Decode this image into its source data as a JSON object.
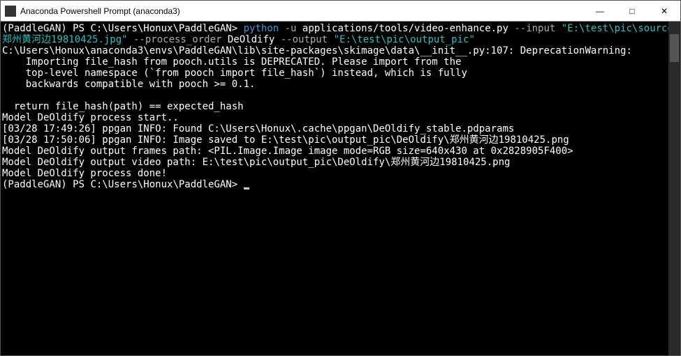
{
  "titlebar": {
    "title": "Anaconda Powershell Prompt (anaconda3)",
    "min": "—",
    "max": "□",
    "close": "✕"
  },
  "term": {
    "prompt_env": "(PaddleGAN) ",
    "prompt_path": "PS C:\\Users\\Honux\\PaddleGAN> ",
    "cmd_python": "python",
    "cmd_flag_u": " -u",
    "cmd_script": " applications/tools/video-enhance.py",
    "cmd_flag_input": " --input",
    "cmd_input_val_1": " \"E:\\test\\pic\\source_pic\\",
    "cmd_input_val_2": "郑州黄河边19810425.jpg\"",
    "cmd_flag_proc": " --process_order",
    "cmd_proc_val": " DeOldify",
    "cmd_flag_out": " --output",
    "cmd_out_val": " \"E:\\test\\pic\\output_pic\"",
    "warn_1": "C:\\Users\\Honux\\anaconda3\\envs\\PaddleGAN\\lib\\site-packages\\skimage\\data\\__init__.py:107: DeprecationWarning:",
    "warn_2": "    Importing file_hash from pooch.utils is DEPRECATED. Please import from the",
    "warn_3": "    top-level namespace (`from pooch import file_hash`) instead, which is fully",
    "warn_4": "    backwards compatible with pooch >= 0.1.",
    "blank": "",
    "ret": "  return file_hash(path) == expected_hash",
    "l1": "Model DeOldify process start..",
    "l2": "[03/28 17:49:26] ppgan INFO: Found C:\\Users\\Honux\\.cache\\ppgan\\DeOldify_stable.pdparams",
    "l3": "[03/28 17:50:06] ppgan INFO: Image saved to E:\\test\\pic\\output_pic\\DeOldify\\郑州黄河边19810425.png",
    "l4": "Model DeOldify output frames path: <PIL.Image.Image image mode=RGB size=640x430 at 0x2828905F400>",
    "l5": "Model DeOldify output video path: E:\\test\\pic\\output_pic\\DeOldify\\郑州黄河边19810425.png",
    "l6": "Model DeOldify process done!"
  }
}
